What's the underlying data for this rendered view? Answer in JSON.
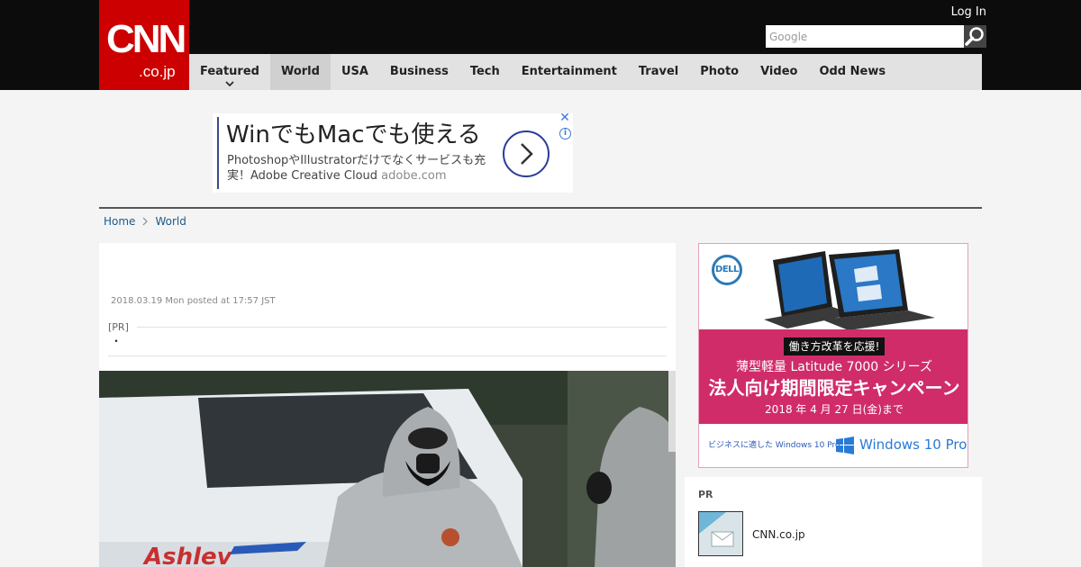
{
  "header": {
    "logo_main": "CNN",
    "logo_sub": ".co.jp",
    "login_label": "Log In",
    "search_placeholder": "Google"
  },
  "nav": {
    "items": [
      {
        "label": "Featured",
        "has_dropdown": true
      },
      {
        "label": "World",
        "active": true
      },
      {
        "label": "USA"
      },
      {
        "label": "Business"
      },
      {
        "label": "Tech"
      },
      {
        "label": "Entertainment"
      },
      {
        "label": "Travel"
      },
      {
        "label": "Photo"
      },
      {
        "label": "Video"
      },
      {
        "label": "Odd News"
      }
    ]
  },
  "top_ad": {
    "headline": "WinでもMacでも使える",
    "body": "PhotoshopやIllustratorだけでなくサービスも充実！Adobe Creative Cloud",
    "domain": "adobe.com",
    "close_glyph": "✕",
    "info_glyph": "i"
  },
  "breadcrumb": {
    "home": "Home",
    "section": "World"
  },
  "article": {
    "dateline": "2018.03.19 Mon posted at 17:57 JST",
    "pr_label": "[PR]",
    "pr_bullet": "・"
  },
  "side_ad": {
    "brand": "DELL",
    "tag": "働き方改革を応援!",
    "line1": "薄型軽量 Latitude 7000 シリーズ",
    "line2": "法人向け期間限定キャンペーン",
    "line3": "2018 年 4 月 27 日(金)まで",
    "foot_left": "ビジネスに適した Windows 10 Pro。",
    "foot_right": "Windows 10 Pro"
  },
  "pr_box": {
    "label": "PR",
    "item_name": "CNN.co.jp"
  },
  "colors": {
    "brand_red": "#cc0000",
    "header_black": "#0c0c0c",
    "nav_gray": "#e2e2e2",
    "link_blue": "#1a5a8a",
    "ad_pink": "#d02c6a"
  }
}
